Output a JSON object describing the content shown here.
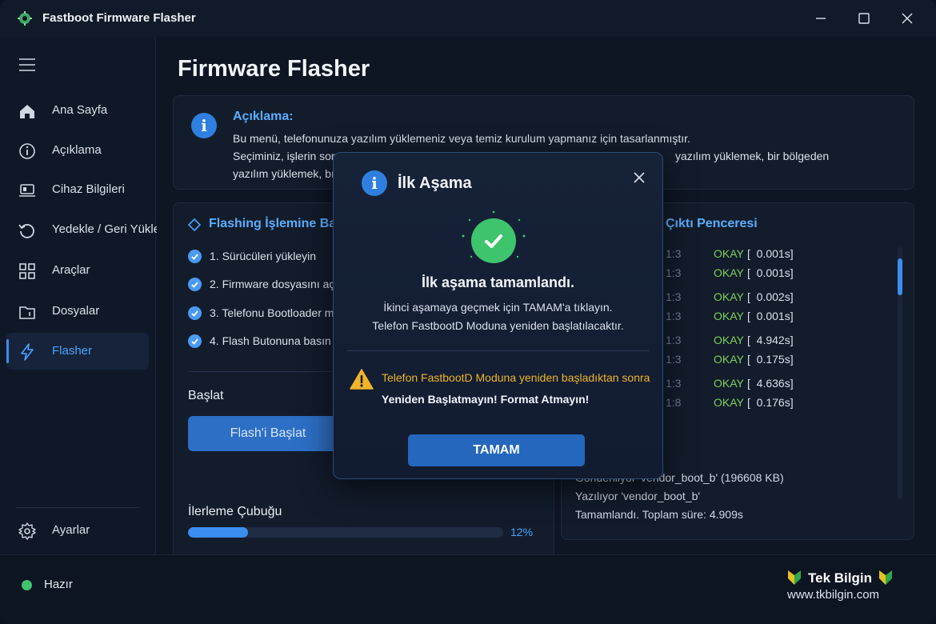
{
  "app": {
    "title": "Fastboot Firmware Flasher"
  },
  "sidebar": {
    "items": [
      {
        "label": "Ana Sayfa",
        "icon": "home-icon"
      },
      {
        "label": "Açıklama",
        "icon": "info-circle-icon"
      },
      {
        "label": "Cihaz Bilgileri",
        "icon": "device-icon"
      },
      {
        "label": "Yedekle / Geri Yükle",
        "icon": "restore-icon"
      },
      {
        "label": "Araçlar",
        "icon": "grid-icon"
      },
      {
        "label": "Dosyalar",
        "icon": "folder-icon"
      },
      {
        "label": "Flasher",
        "icon": "lightning-icon",
        "active": true
      }
    ],
    "settings_label": "Ayarlar"
  },
  "main": {
    "title": "Firmware Flasher",
    "info": {
      "title": "Açıklama:",
      "line1": "Bu menü, telefonunuza yazılım yüklemeniz veya temiz kurulum yapmanız için tasarlanmıştır.",
      "line2_left": "Seçiminiz, işlerin sor",
      "line2_right": "yazılım yüklemek, bir bölgeden",
      "line3_left": "yazılım yüklemek, bı"
    },
    "flash": {
      "title": "Flashing İşlemine Baş",
      "steps": [
        "1. Sürücüleri yükleyin",
        "2. Firmware dosyasını aça",
        "3. Telefonu Bootloader m",
        "4. Flash Butonuna basın"
      ],
      "start_label": "Başlat",
      "start_button": "Flash'i Başlat",
      "progress_label": "İlerleme Çubuğu",
      "progress_percent": "12%",
      "progress_value": 0.19
    },
    "output": {
      "title": "Çıktı Penceresi",
      "log": [
        {
          "time": "1:3",
          "status": "OKAY",
          "value": "[  0.001s]"
        },
        {
          "time": "1:3",
          "status": "OKAY",
          "value": "[  0.001s]"
        },
        {
          "time": "1:3",
          "status": "OKAY",
          "value": "[  0.002s]"
        },
        {
          "time": "1:3",
          "status": "OKAY",
          "value": "[  0.001s]"
        },
        {
          "time": "1:3",
          "status": "OKAY",
          "value": "[  4.942s]"
        },
        {
          "time": "1:3",
          "status": "OKAY",
          "value": "[  0.175s]"
        },
        {
          "time": "1:3",
          "status": "OKAY",
          "value": "[  4.636s]"
        },
        {
          "time": "1:8",
          "status": "OKAY",
          "value": "[  0.176s]"
        }
      ],
      "plain": [
        "Gönderiliyor 'vendor_boot_b' (196608 KB)",
        "Yazılıyor 'vendor_boot_b'",
        "Tamamlandı. Toplam süre: 4.909s"
      ]
    }
  },
  "status": {
    "text": "Hazır",
    "color": "#3ec46d"
  },
  "brand": {
    "name": "Tek Bilgin",
    "url": "www.tkbilgin.com"
  },
  "dialog": {
    "title": "İlk Aşama",
    "heading": "İlk aşama tamamlandı.",
    "text1": "İkinci aşamaya geçmek için TAMAM'a tıklayın.",
    "text2": "Telefon FastbootD Moduna yeniden başlatılacaktır.",
    "warning1": "Telefon FastbootD Moduna yeniden başladıktan sonra",
    "warning2": "Yeniden Başlatmayın! Format Atmayın!",
    "ok_button": "TAMAM"
  },
  "colors": {
    "accent": "#3b8ef0",
    "success": "#3ec46d",
    "warning": "#f0b429",
    "okay": "#7ccf5c"
  }
}
